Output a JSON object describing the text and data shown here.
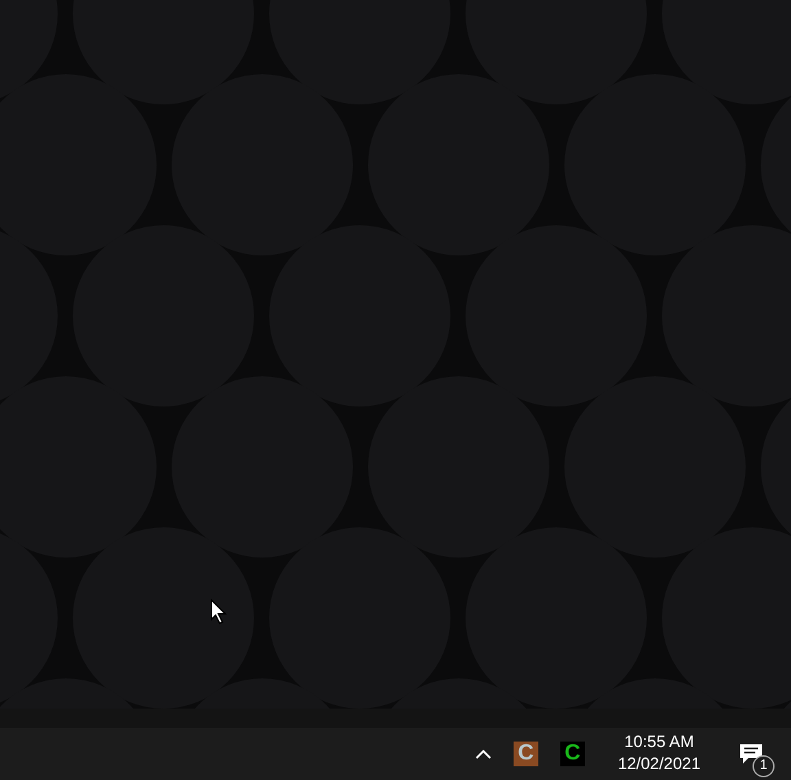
{
  "taskbar": {
    "tray_apps": [
      {
        "letter": "C",
        "color": "#8a4a22"
      },
      {
        "letter": "C",
        "color": "#000000"
      }
    ],
    "clock": {
      "time": "10:55 AM",
      "date": "12/02/2021"
    },
    "notifications": {
      "count": "1"
    }
  }
}
